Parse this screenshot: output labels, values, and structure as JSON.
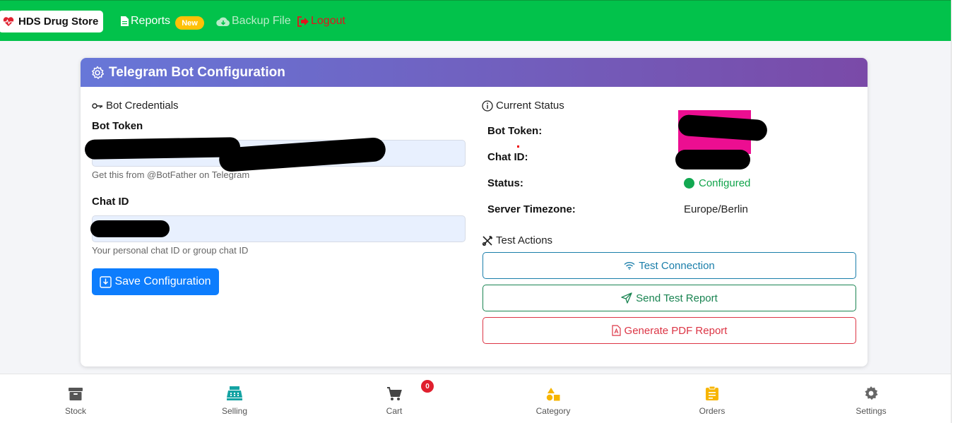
{
  "navbar": {
    "brand": "HDS Drug Store",
    "reports": "Reports",
    "new_badge": "New",
    "backup": "Backup File",
    "logout": "Logout",
    "colors": {
      "bg": "#02c24b",
      "badge": "#ffc107",
      "logout": "#e0141e"
    }
  },
  "card": {
    "title": "Telegram Bot Configuration",
    "credentials": {
      "section_title": "Bot Credentials",
      "token_label": "Bot Token",
      "token_help": "Get this from @BotFather on Telegram",
      "chat_label": "Chat ID",
      "chat_help": "Your personal chat ID or group chat ID",
      "save_button": "Save Configuration"
    },
    "status": {
      "section_title": "Current Status",
      "bot_token_label": "Bot Token:",
      "chat_id_label": "Chat ID:",
      "status_label": "Status:",
      "status_value": "Configured",
      "timezone_label": "Server Timezone:",
      "timezone_value": "Europe/Berlin"
    },
    "actions": {
      "section_title": "Test Actions",
      "test_connection": "Test Connection",
      "send_test_report": "Send Test Report",
      "generate_pdf": "Generate PDF Report"
    }
  },
  "bottom_nav": {
    "items": [
      {
        "label": "Stock",
        "icon": "archive-icon"
      },
      {
        "label": "Selling",
        "icon": "cash-register-icon"
      },
      {
        "label": "Cart",
        "icon": "cart-icon"
      },
      {
        "label": "Category",
        "icon": "shapes-icon"
      },
      {
        "label": "Orders",
        "icon": "clipboard-icon"
      },
      {
        "label": "Settings",
        "icon": "gear-icon"
      }
    ],
    "cart_count": "0"
  }
}
